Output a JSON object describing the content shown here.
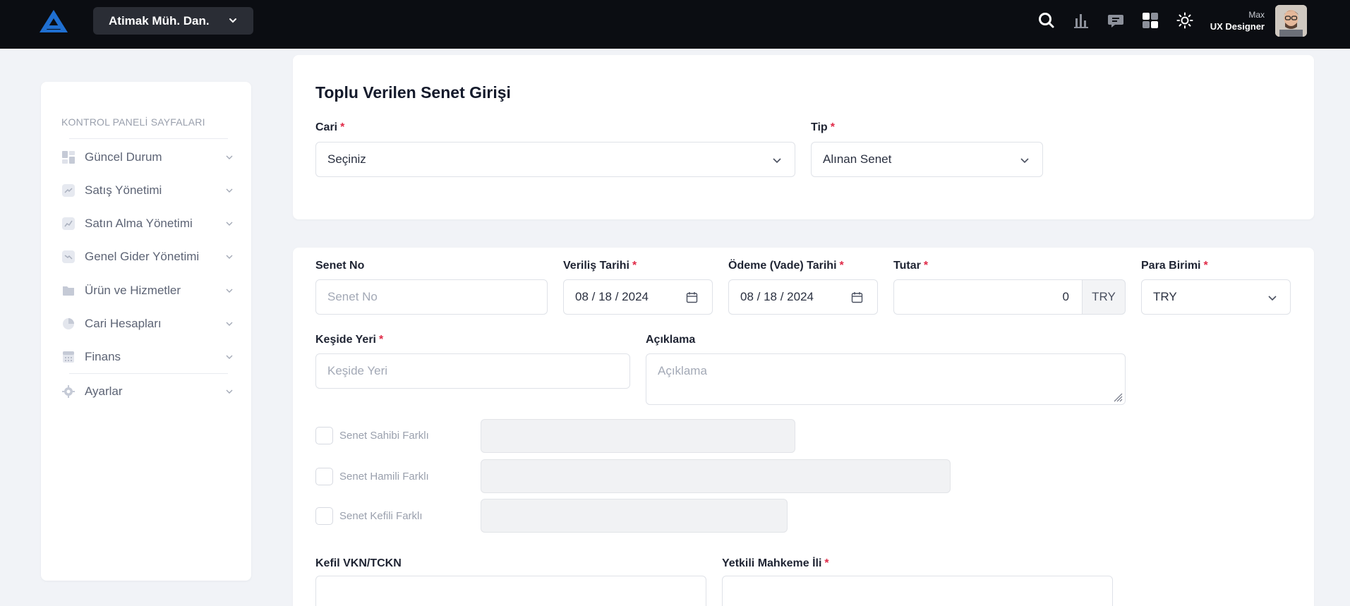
{
  "topbar": {
    "company": "Atimak Müh. Dan.",
    "user_name": "Max",
    "user_role": "UX Designer",
    "icons": [
      "search-icon",
      "bar-chart-icon",
      "chat-icon",
      "apps-grid-icon",
      "theme-sun-icon"
    ]
  },
  "sidebar": {
    "title": "KONTROL PANELİ SAYFALARI",
    "items": [
      {
        "label": "Güncel Durum",
        "icon": "dashboard-icon"
      },
      {
        "label": "Satış Yönetimi",
        "icon": "sales-chart-icon"
      },
      {
        "label": "Satın Alma Yönetimi",
        "icon": "purchase-chart-icon"
      },
      {
        "label": "Genel Gider Yönetimi",
        "icon": "expense-chart-icon"
      },
      {
        "label": "Ürün ve Hizmetler",
        "icon": "folder-icon"
      },
      {
        "label": "Cari Hesapları",
        "icon": "pie-chart-icon"
      },
      {
        "label": "Finans",
        "icon": "calculator-icon"
      },
      {
        "label": "Ayarlar",
        "icon": "gear-icon"
      }
    ]
  },
  "form": {
    "title": "Toplu Verilen Senet Girişi",
    "cari": {
      "label": "Cari",
      "value": "Seçiniz"
    },
    "tip": {
      "label": "Tip",
      "value": "Alınan Senet"
    },
    "senet_no": {
      "label": "Senet No",
      "placeholder": "Senet No"
    },
    "verilis_tarihi": {
      "label": "Veriliş Tarihi",
      "value": "08 / 18 / 2024"
    },
    "odeme_tarihi": {
      "label": "Ödeme (Vade) Tarihi",
      "value": "08 / 18 / 2024"
    },
    "tutar": {
      "label": "Tutar",
      "value": "0",
      "currency": "TRY"
    },
    "para_birimi": {
      "label": "Para Birimi",
      "value": "TRY"
    },
    "keside_yeri": {
      "label": "Keşide Yeri",
      "placeholder": "Keşide Yeri"
    },
    "aciklama": {
      "label": "Açıklama",
      "placeholder": "Açıklama"
    },
    "checks": [
      {
        "label": "Senet Sahibi Farklı",
        "checked": false
      },
      {
        "label": "Senet Hamili Farklı",
        "checked": false
      },
      {
        "label": "Senet Kefili Farklı",
        "checked": false
      }
    ],
    "kefil_vkn": {
      "label": "Kefil VKN/TCKN"
    },
    "yetkili_mahkeme": {
      "label": "Yetkili Mahkeme İli"
    },
    "required_mark": "*"
  },
  "colors": {
    "topbar_bg": "#0b0d12",
    "required": "#e02b48",
    "page_bg": "#f1f3f7"
  }
}
